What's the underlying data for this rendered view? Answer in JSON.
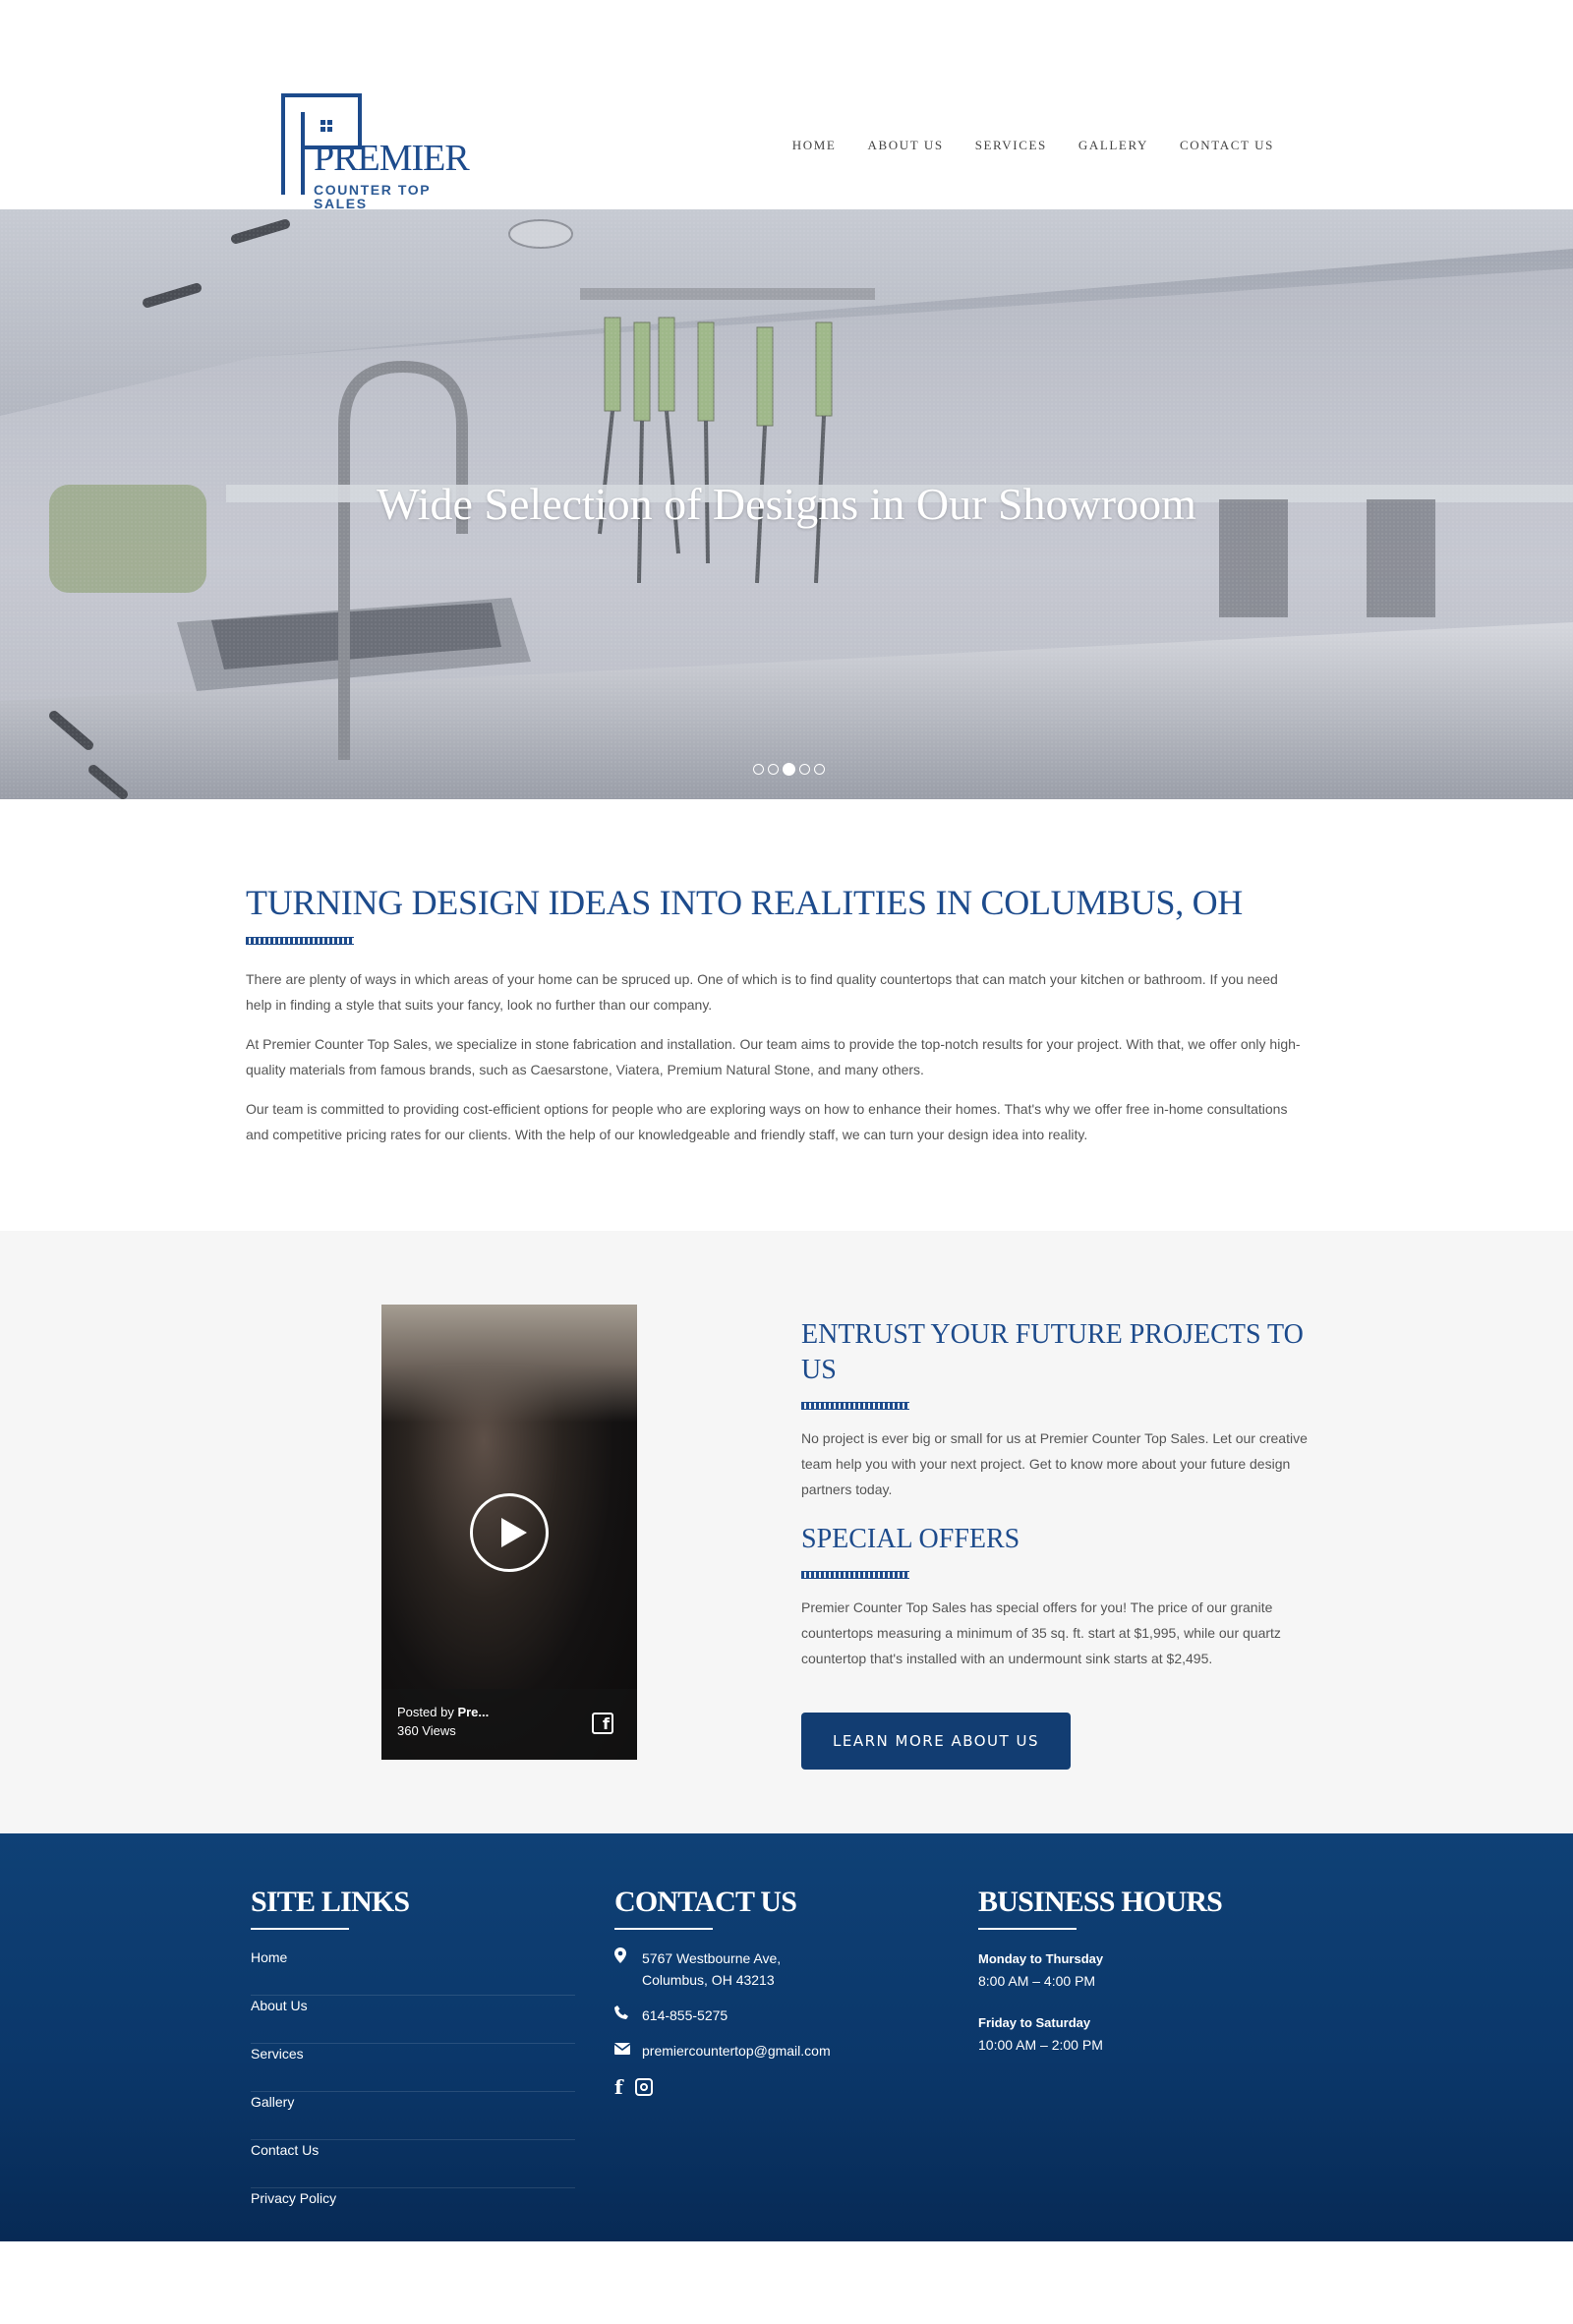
{
  "header": {
    "logo": {
      "word": "PREMIER",
      "sub": "COUNTER TOP SALES"
    },
    "nav": [
      "HOME",
      "ABOUT US",
      "SERVICES",
      "GALLERY",
      "CONTACT US"
    ]
  },
  "hero": {
    "title": "Wide Selection of Designs in Our Showroom",
    "slides_total": 5,
    "active_slide": 3
  },
  "about": {
    "heading": "TURNING DESIGN IDEAS INTO REALITIES IN COLUMBUS, OH",
    "paragraphs": [
      "There are plenty of ways in which areas of your home can be spruced up. One of which is to find quality countertops that can match your kitchen or bathroom. If you need help in finding a style that suits your fancy, look no further than our company.",
      "At Premier Counter Top Sales, we specialize in stone fabrication and installation. Our team aims to provide the top-notch results for your project. With that, we offer only high-quality materials from famous brands, such as Caesarstone, Viatera, Premium Natural Stone, and many others.",
      "Our team is committed to providing cost-efficient options for people who are exploring ways on how to enhance their homes. That's why we offer free in-home consultations and competitive pricing rates for our clients. With the help of our knowledgeable and friendly staff, we can turn your design idea into reality."
    ]
  },
  "video": {
    "posted_prefix": "Posted by ",
    "posted_by": "Pre...",
    "views": "360 Views"
  },
  "entrust": {
    "heading": "ENTRUST YOUR FUTURE PROJECTS TO US",
    "text": "No project is ever big or small for us at Premier Counter Top Sales. Let our creative team help you with your next project. Get to know more about your future design partners today."
  },
  "offers": {
    "heading": "SPECIAL OFFERS",
    "text": "Premier Counter Top Sales has special offers for you! The price of our granite countertops measuring a minimum of 35 sq. ft. start at $1,995, while our quartz countertop that's installed with an undermount sink starts at $2,495.",
    "button": "LEARN MORE ABOUT US"
  },
  "footer": {
    "site_links": {
      "heading": "SITE LINKS",
      "links": [
        "Home",
        "About Us",
        "Services",
        "Gallery",
        "Contact Us",
        "Privacy Policy"
      ]
    },
    "contact": {
      "heading": "CONTACT US",
      "address_line1": "5767 Westbourne Ave,",
      "address_line2": "Columbus, OH 43213",
      "phone": "614-855-5275",
      "email": "premiercountertop@gmail.com"
    },
    "hours": {
      "heading": "BUSINESS HOURS",
      "blocks": [
        {
          "days": "Monday to Thursday",
          "time": "8:00 AM – 4:00 PM"
        },
        {
          "days": "Friday to Saturday",
          "time": "10:00 AM – 2:00 PM"
        }
      ]
    }
  },
  "colors": {
    "brand_blue": "#1d4b8c",
    "button_blue": "#123d72",
    "footer_blue": "#0b376a"
  }
}
